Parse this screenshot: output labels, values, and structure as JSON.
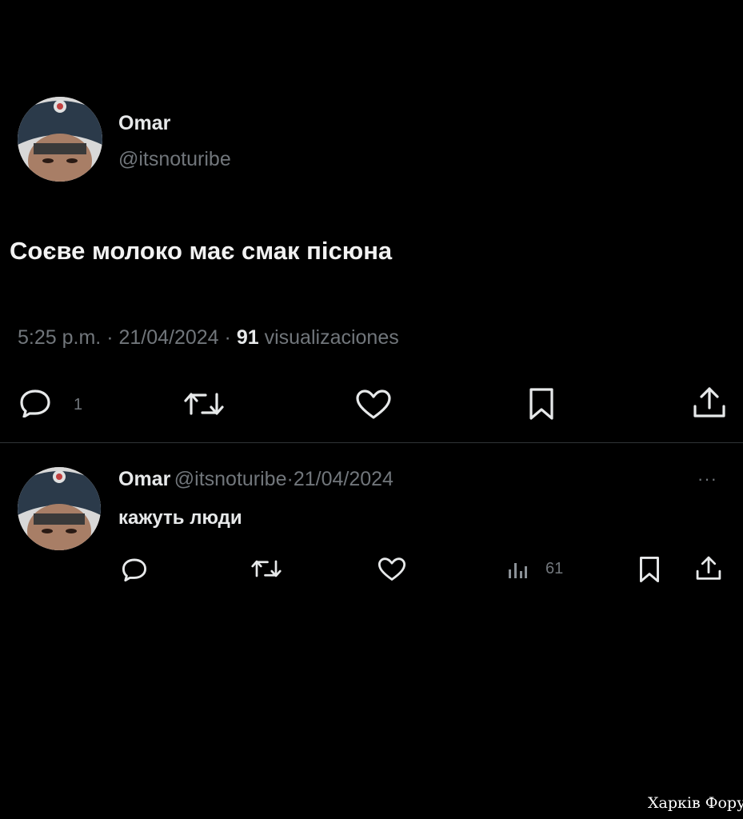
{
  "main_tweet": {
    "author_name": "Omar",
    "author_handle": "@itsnoturibe",
    "text": "Соєве молоко має смак пісюна",
    "time": "5:25 p.m.",
    "separator": "·",
    "date": "21/04/2024",
    "views_count": "91",
    "views_label": "visualizaciones",
    "reply_count": "1"
  },
  "reply_tweet": {
    "author_name": "Omar",
    "author_handle": "@itsnoturibe",
    "date": "21/04/2024",
    "separator": "·",
    "more_label": "···",
    "text": "кажуть люди",
    "views_count": "61"
  },
  "watermark": "Харків Форум",
  "colors": {
    "background": "#000000",
    "primary_text": "#e7e9ea",
    "secondary_text": "#71767b",
    "divider": "#2f3336"
  },
  "icons": {
    "reply": "speech-bubble-icon",
    "retweet": "retweet-arrows-icon",
    "like": "heart-icon",
    "bookmark": "bookmark-icon",
    "share": "share-upload-icon",
    "views": "bar-chart-icon"
  }
}
